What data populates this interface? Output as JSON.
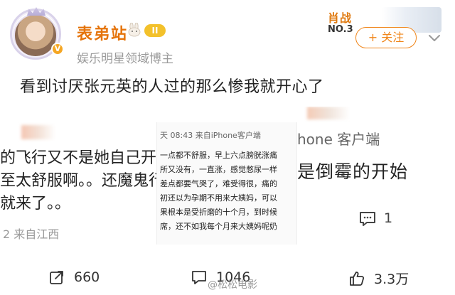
{
  "header": {
    "user_name": "表弟站",
    "level_badge": "II",
    "verification": "娱乐明星领域博主",
    "star_tag": {
      "name": "肖战",
      "rank": "NO.3"
    },
    "follow_label": "+ 关注"
  },
  "post": {
    "text": "看到讨厌张元英的人过的那么惨我就开心了"
  },
  "left_snippet": {
    "line1": "的飞行又不是她自己开",
    "line2": "至太舒服啊。。还魔鬼行",
    "line3": "就来了。。",
    "meta": "2 来自江西"
  },
  "middle_snippet": {
    "head": "天 08:43  来自iPhone客户端",
    "lines": [
      "一点都不舒服，早上六点膀胱涨痛",
      "所又没有，一直涨，感觉憋尿一样",
      "差点都要气哭了，难受得很，痛的",
      "初还以为孕期不用来大姨妈，可以",
      "果根本是受折磨的十个月，到时候",
      "席，还不如我每个月来大姨妈呢奶"
    ]
  },
  "right_snippet": {
    "client": "hone 客户端",
    "big_text": "是倒霉的开始",
    "comment_count": "1"
  },
  "actions": {
    "repost": "660",
    "comment": "1046",
    "like": "3.3万"
  },
  "watermark": "@松松电影",
  "colors": {
    "brand_orange": "#e5740b",
    "follow_orange": "#f08519",
    "muted_gray": "#9a9a9a"
  }
}
